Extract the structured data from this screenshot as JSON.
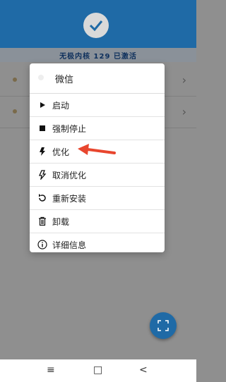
{
  "header": {
    "status_text": "无极内核 129 已激活"
  },
  "menu": {
    "app_name": "微信",
    "items": [
      {
        "label": "启动",
        "icon": "play-icon"
      },
      {
        "label": "强制停止",
        "icon": "stop-icon"
      },
      {
        "label": "优化",
        "icon": "lightning-icon"
      },
      {
        "label": "取消优化",
        "icon": "lightning-off-icon"
      },
      {
        "label": "重新安装",
        "icon": "reinstall-icon"
      },
      {
        "label": "卸载",
        "icon": "trash-icon"
      },
      {
        "label": "详细信息",
        "icon": "info-icon"
      }
    ]
  },
  "nav": {
    "menu": "≡",
    "home": "□",
    "back": "<"
  },
  "colors": {
    "accent": "#1f6aa6",
    "arrow": "#e8462e"
  }
}
